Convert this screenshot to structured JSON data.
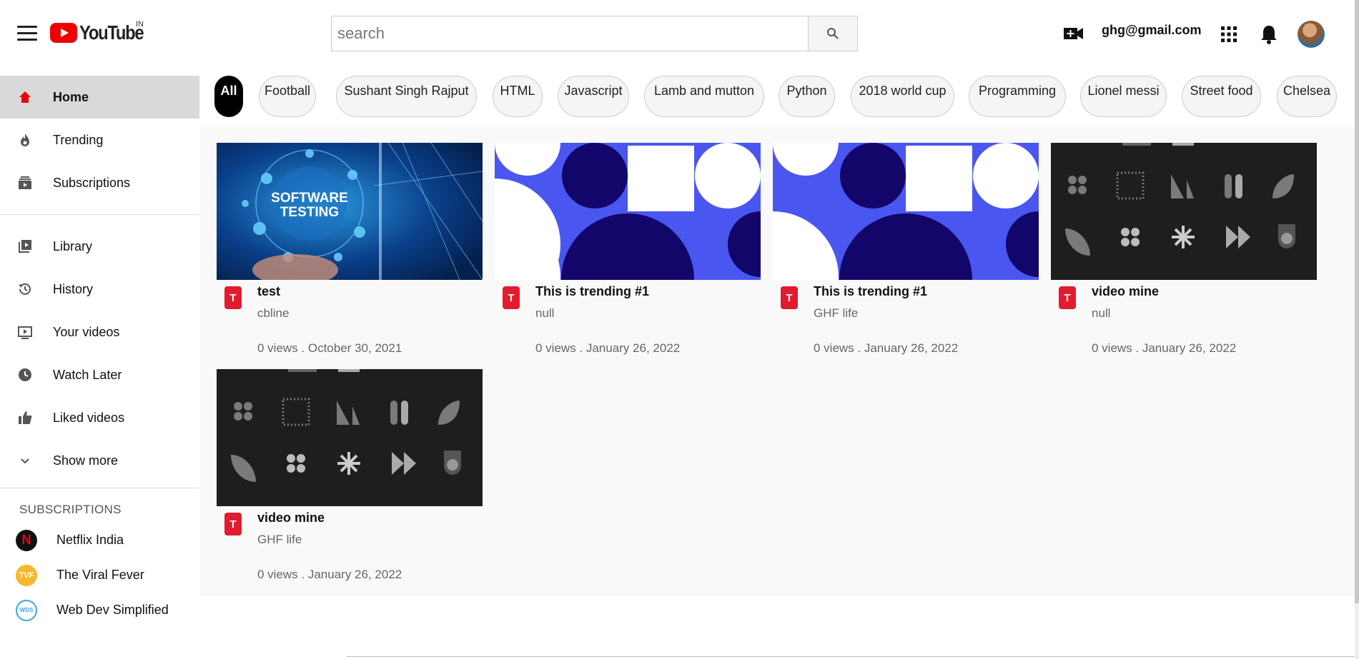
{
  "header": {
    "logo_text": "YouTube",
    "logo_sup": "IN",
    "search_placeholder": "search",
    "email": "ghg@gmail.com"
  },
  "sidebar": {
    "main": [
      {
        "label": "Home",
        "icon": "home-icon"
      },
      {
        "label": "Trending",
        "icon": "fire-icon"
      },
      {
        "label": "Subscriptions",
        "icon": "subscriptions-icon"
      }
    ],
    "library": [
      {
        "label": "Library",
        "icon": "library-icon"
      },
      {
        "label": "History",
        "icon": "history-icon"
      },
      {
        "label": "Your videos",
        "icon": "your-videos-icon"
      },
      {
        "label": "Watch Later",
        "icon": "clock-icon"
      },
      {
        "label": "Liked videos",
        "icon": "thumbs-up-icon"
      },
      {
        "label": "Show more",
        "icon": "chevron-down-icon"
      }
    ],
    "subscriptions_title": "SUBSCRIPTIONS",
    "subscriptions": [
      {
        "label": "Netflix India",
        "badge": "N",
        "color": "#111111"
      },
      {
        "label": "The Viral Fever",
        "badge": "TVF",
        "color": "#f5b82e"
      },
      {
        "label": "Web Dev Simplified",
        "badge": "WDS",
        "color": "#3aa7e0"
      }
    ]
  },
  "chips": [
    "All",
    "Football",
    "Sushant Singh Rajput",
    "HTML",
    "Javascript",
    "Lamb and mutton",
    "Python",
    "2018 world cup",
    "Programming",
    "Lionel messi",
    "Street food",
    "Chelsea"
  ],
  "videos": [
    {
      "title": "test",
      "channel": "cbline",
      "stats": "0 views . October 30, 2021",
      "thumb": "software-testing",
      "thumb_text": [
        "SOFTWARE",
        "TESTING"
      ]
    },
    {
      "title": "This is trending #1",
      "channel": "null",
      "stats": "0 views . January 26, 2022",
      "thumb": "blue-shapes"
    },
    {
      "title": "This is trending #1",
      "channel": "GHF life",
      "stats": "0 views . January 26, 2022",
      "thumb": "blue-shapes"
    },
    {
      "title": "video mine",
      "channel": "null",
      "stats": "0 views . January 26, 2022",
      "thumb": "dark-icons"
    },
    {
      "title": "video mine",
      "channel": "GHF life",
      "stats": "0 views . January 26, 2022",
      "thumb": "dark-icons"
    }
  ],
  "colors": {
    "brand_red": "#ff0000",
    "active_nav": "#d9d9d9",
    "content_bg": "#f9f9f9",
    "shape_blue": "#4a56f0",
    "shape_navy": "#12066b"
  }
}
